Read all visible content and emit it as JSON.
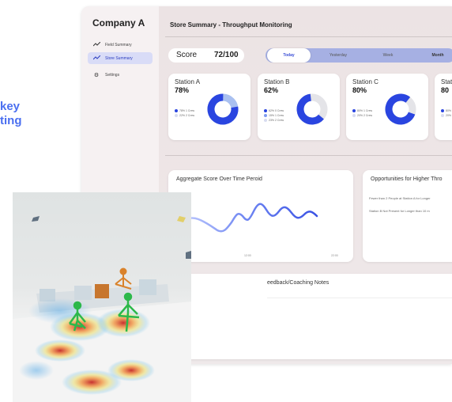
{
  "caption": {
    "line1": "key",
    "line2": "ting"
  },
  "sidebar": {
    "brand": "Company A",
    "items": [
      {
        "label": "Field Summary",
        "icon": "trend-icon",
        "active": false
      },
      {
        "label": "Store Summary",
        "icon": "trend-icon",
        "active": true
      },
      {
        "label": "Settings",
        "icon": "gear-icon",
        "active": false
      }
    ]
  },
  "header": {
    "title": "Store Summary - Throughput Monitoring"
  },
  "score": {
    "label": "Score",
    "value": "72/100"
  },
  "tabs": [
    {
      "label": "Today",
      "active": true
    },
    {
      "label": "Yesterday",
      "active": false
    },
    {
      "label": "Week",
      "active": false
    },
    {
      "label": "Month",
      "active": false
    }
  ],
  "stations": [
    {
      "name": "Station A",
      "pct": "78%",
      "value": 0.78,
      "legend": [
        "78% 1 Crew",
        "22% 2 Crew"
      ]
    },
    {
      "name": "Station B",
      "pct": "62%",
      "value": 0.62,
      "legend": [
        "62% 0 Crew",
        "15% 1 Crew",
        "23% 2 Crew"
      ]
    },
    {
      "name": "Station C",
      "pct": "80%",
      "value": 0.8,
      "legend": [
        "80% 1 Crew",
        "20% 2 Crew"
      ]
    },
    {
      "name": "Stati",
      "pct": "80",
      "value": 0.8,
      "legend": [
        "80%",
        "20%"
      ]
    }
  ],
  "aggregate": {
    "title": "Aggregate Score Over Time Peroid",
    "y_tick": "100%",
    "x_ticks": [
      "",
      "12:00",
      "22:00"
    ]
  },
  "opportunities": {
    "title": "Opportunities for Higher Thro",
    "lines": [
      "Fewer than 2 People at Station A for Longer",
      "Station B Not Present for Longer than 10 m"
    ]
  },
  "notes": {
    "title": "eedback/Coaching Notes"
  },
  "colors": {
    "accent": "#2a45e0",
    "light": "#a9c0f0",
    "grey": "#e4e4e8",
    "tab_bar": "#a6b0e3"
  }
}
